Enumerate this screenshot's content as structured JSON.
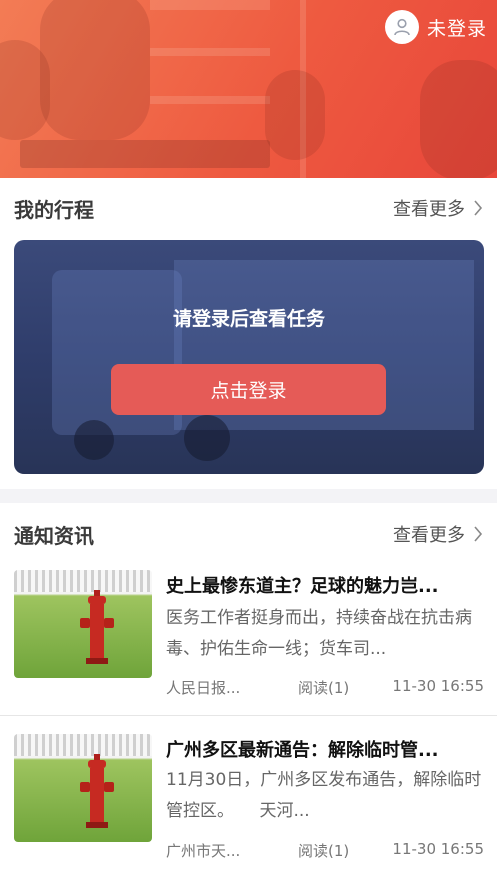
{
  "header": {
    "login_status": "未登录",
    "avatar_icon": "user-icon"
  },
  "trip": {
    "title": "我的行程",
    "more": "查看更多",
    "message": "请登录后查看任务",
    "login_button": "点击登录"
  },
  "news": {
    "title": "通知资讯",
    "more": "查看更多",
    "items": [
      {
        "title": "史上最惨东道主？足球的魅力岂...",
        "summary": "医务工作者挺身而出，持续奋战在抗击病毒、护佑生命一线；货车司...",
        "source": "人民日报...",
        "reads": "阅读(1)",
        "time": "11-30 16:55",
        "thumb_icon": "fire-hydrant-image"
      },
      {
        "title": "广州多区最新通告：解除临时管...",
        "summary": "11月30日，广州多区发布通告，解除临时管控区。　　天河...",
        "source": "广州市天...",
        "reads": "阅读(1)",
        "time": "11-30 16:55",
        "thumb_icon": "fire-hydrant-image"
      }
    ]
  },
  "colors": {
    "hero_orange": "#ee5a40",
    "card_navy": "#2f3d6b",
    "login_button_red": "#e55b57"
  }
}
